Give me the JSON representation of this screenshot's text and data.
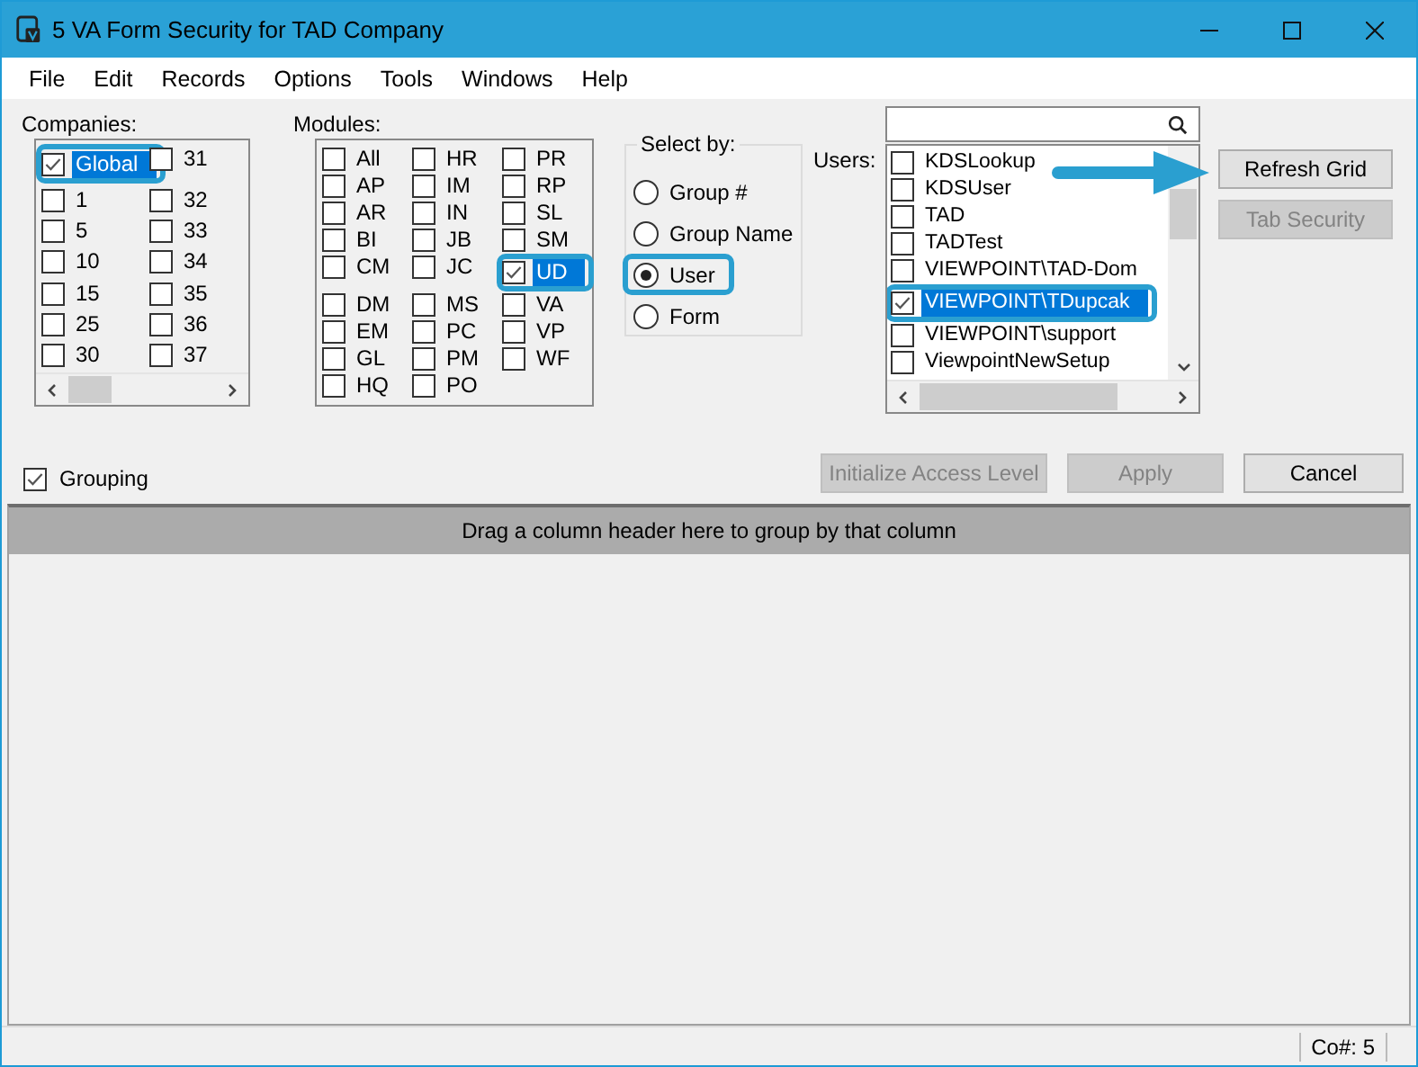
{
  "window": {
    "title": "5 VA Form Security for TAD Company"
  },
  "menu": [
    "File",
    "Edit",
    "Records",
    "Options",
    "Tools",
    "Windows",
    "Help"
  ],
  "companies": {
    "label": "Companies:",
    "items": [
      {
        "label": "Global",
        "checked": true,
        "selected": true
      },
      {
        "label": "1",
        "checked": false,
        "selected": false
      },
      {
        "label": "5",
        "checked": false,
        "selected": false
      },
      {
        "label": "10",
        "checked": false,
        "selected": false
      },
      {
        "label": "15",
        "checked": false,
        "selected": false
      },
      {
        "label": "25",
        "checked": false,
        "selected": false
      },
      {
        "label": "30",
        "checked": false,
        "selected": false
      },
      {
        "label": "31",
        "checked": false,
        "selected": false
      },
      {
        "label": "32",
        "checked": false,
        "selected": false
      },
      {
        "label": "33",
        "checked": false,
        "selected": false
      },
      {
        "label": "34",
        "checked": false,
        "selected": false
      },
      {
        "label": "35",
        "checked": false,
        "selected": false
      },
      {
        "label": "36",
        "checked": false,
        "selected": false
      },
      {
        "label": "37",
        "checked": false,
        "selected": false
      }
    ]
  },
  "modules": {
    "label": "Modules:",
    "items": [
      {
        "label": "All",
        "checked": false,
        "selected": false
      },
      {
        "label": "AP",
        "checked": false,
        "selected": false
      },
      {
        "label": "AR",
        "checked": false,
        "selected": false
      },
      {
        "label": "BI",
        "checked": false,
        "selected": false
      },
      {
        "label": "CM",
        "checked": false,
        "selected": false
      },
      {
        "label": "DM",
        "checked": false,
        "selected": false
      },
      {
        "label": "EM",
        "checked": false,
        "selected": false
      },
      {
        "label": "GL",
        "checked": false,
        "selected": false
      },
      {
        "label": "HQ",
        "checked": false,
        "selected": false
      },
      {
        "label": "HR",
        "checked": false,
        "selected": false
      },
      {
        "label": "IM",
        "checked": false,
        "selected": false
      },
      {
        "label": "IN",
        "checked": false,
        "selected": false
      },
      {
        "label": "JB",
        "checked": false,
        "selected": false
      },
      {
        "label": "JC",
        "checked": false,
        "selected": false
      },
      {
        "label": "MS",
        "checked": false,
        "selected": false
      },
      {
        "label": "PC",
        "checked": false,
        "selected": false
      },
      {
        "label": "PM",
        "checked": false,
        "selected": false
      },
      {
        "label": "PO",
        "checked": false,
        "selected": false
      },
      {
        "label": "PR",
        "checked": false,
        "selected": false
      },
      {
        "label": "RP",
        "checked": false,
        "selected": false
      },
      {
        "label": "SL",
        "checked": false,
        "selected": false
      },
      {
        "label": "SM",
        "checked": false,
        "selected": false
      },
      {
        "label": "UD",
        "checked": true,
        "selected": true
      },
      {
        "label": "VA",
        "checked": false,
        "selected": false
      },
      {
        "label": "VP",
        "checked": false,
        "selected": false
      },
      {
        "label": "WF",
        "checked": false,
        "selected": false
      }
    ]
  },
  "select_by": {
    "label": "Select by:",
    "options": [
      {
        "label": "Group #",
        "selected": false
      },
      {
        "label": "Group Name",
        "selected": false
      },
      {
        "label": "User",
        "selected": true
      },
      {
        "label": "Form",
        "selected": false
      }
    ]
  },
  "users": {
    "label": "Users:",
    "items": [
      {
        "label": "KDSLookup",
        "checked": false,
        "selected": false
      },
      {
        "label": "KDSUser",
        "checked": false,
        "selected": false
      },
      {
        "label": "TAD",
        "checked": false,
        "selected": false
      },
      {
        "label": "TADTest",
        "checked": false,
        "selected": false
      },
      {
        "label": "VIEWPOINT\\TAD-Dom",
        "checked": false,
        "selected": false
      },
      {
        "label": "VIEWPOINT\\TDupcak",
        "checked": true,
        "selected": true
      },
      {
        "label": "VIEWPOINT\\support",
        "checked": false,
        "selected": false
      },
      {
        "label": "ViewpointNewSetup",
        "checked": false,
        "selected": false
      }
    ]
  },
  "side_buttons": [
    {
      "label": "Refresh Grid",
      "disabled": false
    },
    {
      "label": "Tab Security",
      "disabled": true
    }
  ],
  "grouping": {
    "label": "Grouping",
    "checked": true
  },
  "action_buttons": [
    {
      "label": "Initialize Access Level",
      "disabled": true
    },
    {
      "label": "Apply",
      "disabled": true
    },
    {
      "label": "Cancel",
      "disabled": false
    }
  ],
  "grid": {
    "group_hint": "Drag a column header here to group by that column"
  },
  "status_bar": {
    "company": "Co#: 5"
  }
}
